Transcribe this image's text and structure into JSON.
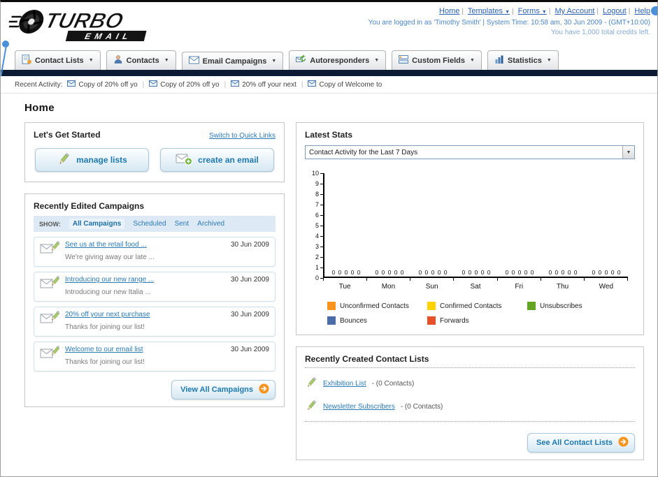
{
  "colors": {
    "link_blue": "#2a7ab5",
    "accent_orange": "#f7941d",
    "dark_bar": "#0c1a33"
  },
  "header": {
    "logo_title": "TURBO",
    "logo_subtitle": "EMAIL",
    "links": [
      "Home",
      "Templates",
      "Forms",
      "My Account",
      "Logout",
      "Help"
    ],
    "login_info": "You are logged in as 'Timothy Smith' | System Time: 10:58 am, 30 Jun 2009 - (GMT+10:00)",
    "credits": "You have 1,000 total credits left."
  },
  "nav_tabs": [
    {
      "label": "Contact Lists"
    },
    {
      "label": "Contacts"
    },
    {
      "label": "Email Campaigns"
    },
    {
      "label": "Autoresponders"
    },
    {
      "label": "Custom Fields"
    },
    {
      "label": "Statistics"
    }
  ],
  "recent_activity": {
    "label": "Recent Activity:",
    "items": [
      "Copy of 20% off yo",
      "Copy of 20% off yo",
      "20% off your next",
      "Copy of Welcome to"
    ]
  },
  "page_title": "Home",
  "get_started": {
    "title": "Let's Get Started",
    "switch_link": "Switch to Quick Links",
    "manage_lists_label": "manage lists",
    "create_email_label": "create an email"
  },
  "campaigns": {
    "title": "Recently Edited Campaigns",
    "show_label": "SHOW:",
    "filters": [
      "All Campaigns",
      "Scheduled",
      "Sent",
      "Archived"
    ],
    "items": [
      {
        "title": "See us at the retail food ...",
        "subtitle": "We're giving away our late ...",
        "date": "30 Jun 2009"
      },
      {
        "title": "Introducing our new range ...",
        "subtitle": "Introducing our new Italia ...",
        "date": "30 Jun 2009"
      },
      {
        "title": "20% off your next purchase",
        "subtitle": "Thanks for joining our list!",
        "date": "30 Jun 2009"
      },
      {
        "title": "Welcome to our email list",
        "subtitle": "Thanks for joining our list!",
        "date": "30 Jun 2009"
      }
    ],
    "view_all_label": "View All Campaigns"
  },
  "stats": {
    "title": "Latest Stats",
    "dropdown_value": "Contact Activity for the Last 7 Days"
  },
  "chart_data": {
    "type": "bar",
    "title": "Contact Activity for the Last 7 Days",
    "categories": [
      "Tue",
      "Mon",
      "Sun",
      "Sat",
      "Fri",
      "Thu",
      "Wed"
    ],
    "series": [
      {
        "name": "Unconfirmed Contacts",
        "color": "#f7941d",
        "values": [
          0,
          0,
          0,
          0,
          0,
          0,
          0
        ]
      },
      {
        "name": "Confirmed Contacts",
        "color": "#ffd200",
        "values": [
          0,
          0,
          0,
          0,
          0,
          0,
          0
        ]
      },
      {
        "name": "Unsubscribes",
        "color": "#64a423",
        "values": [
          0,
          0,
          0,
          0,
          0,
          0,
          0
        ]
      },
      {
        "name": "Bounces",
        "color": "#4a6da7",
        "values": [
          0,
          0,
          0,
          0,
          0,
          0,
          0
        ]
      },
      {
        "name": "Forwards",
        "color": "#e8502a",
        "values": [
          0,
          0,
          0,
          0,
          0,
          0,
          0
        ]
      }
    ],
    "ylim": [
      0,
      10
    ],
    "yticks": [
      10,
      9,
      8,
      7,
      6,
      5,
      4,
      3,
      2,
      1,
      0
    ],
    "value_labels": "0 0 0 0 0",
    "grid": false,
    "legend_position": "bottom"
  },
  "contact_lists": {
    "title": "Recently Created Contact Lists",
    "items": [
      {
        "name": "Exhibition List",
        "suffix": "- (0 Contacts)"
      },
      {
        "name": "Newsletter Subscribers",
        "suffix": "- (0 Contacts)"
      }
    ],
    "see_all_label": "See All Contact Lists"
  }
}
